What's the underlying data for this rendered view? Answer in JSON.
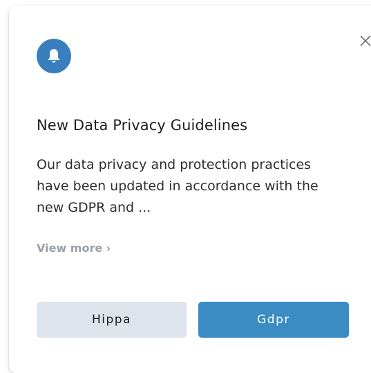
{
  "notification": {
    "title": "New Data Privacy Guidelines",
    "body": "Our data privacy and protection practices have been updated in accordance with the new GDPR and ...",
    "view_more_label": "View more ›",
    "icon": "bell-icon",
    "close_icon": "close-icon"
  },
  "actions": {
    "secondary_label": "Hippa",
    "primary_label": "Gdpr"
  },
  "colors": {
    "accent": "#3b8bc4",
    "icon_badge": "#3a7fbd",
    "secondary_button": "#dde4eb",
    "muted_link": "#9aa0a6"
  }
}
